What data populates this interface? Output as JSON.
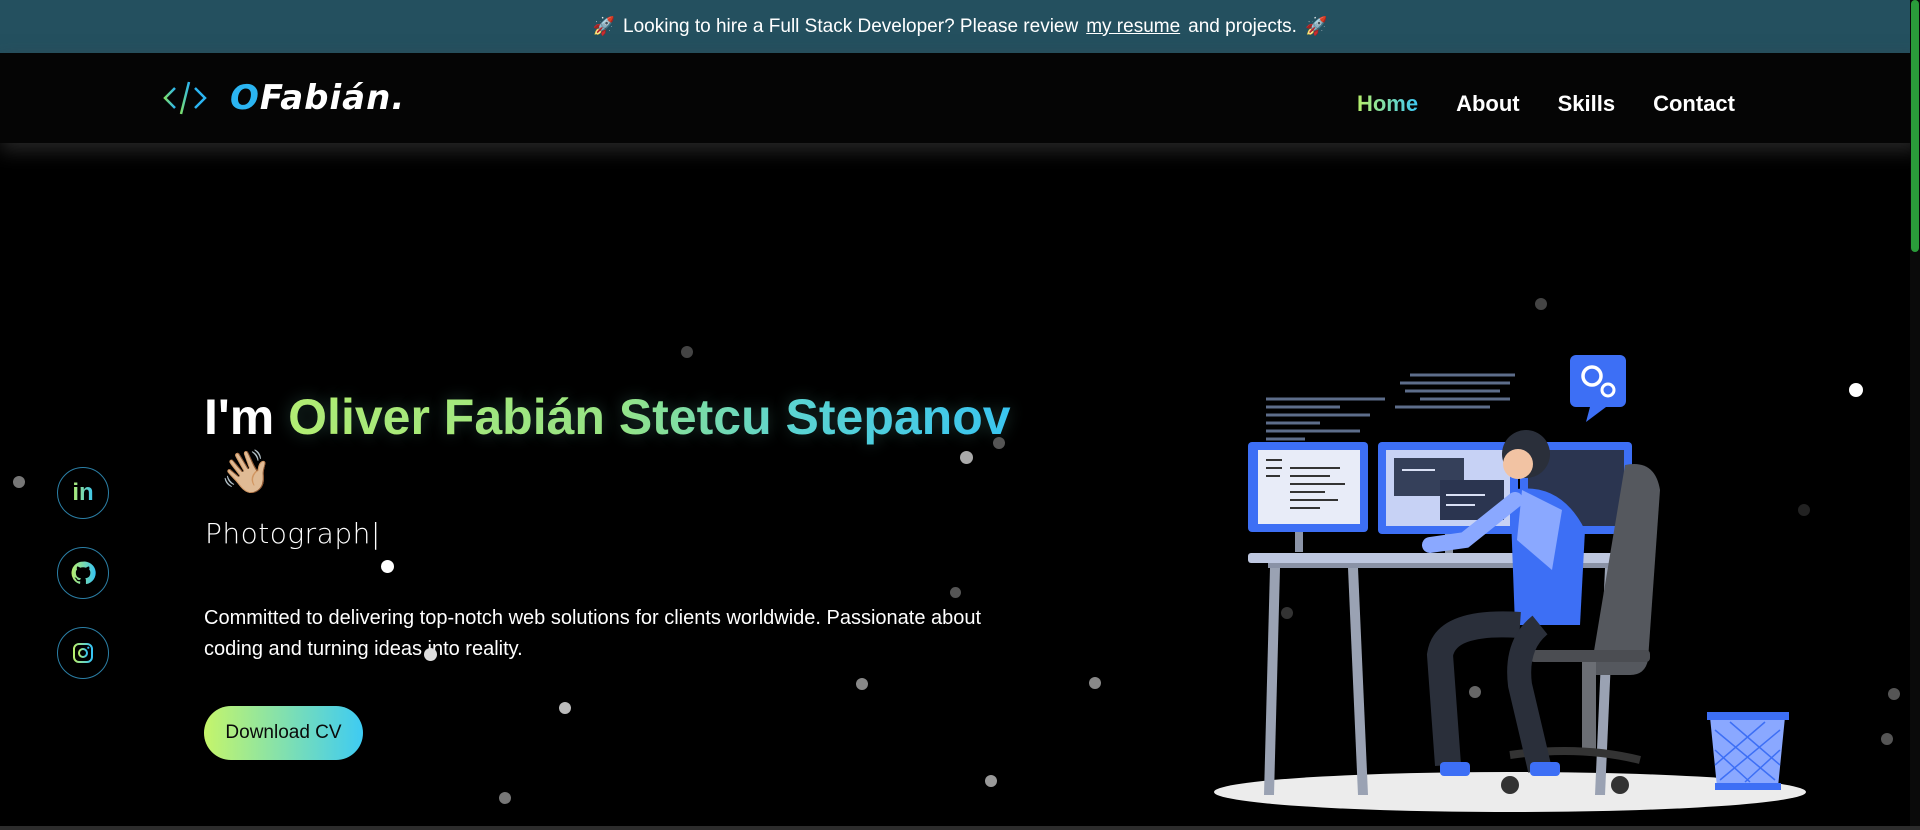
{
  "banner": {
    "text_before": "Looking to hire a Full Stack Developer? Please review",
    "link_text": "my resume",
    "text_after": "and projects.",
    "icon": "rocket-icon"
  },
  "logo": {
    "icon": "code-brackets-icon",
    "text_o": "O",
    "text_rest": "Fabián."
  },
  "nav": {
    "items": [
      "Home",
      "About",
      "Skills",
      "Contact"
    ],
    "active": "Home"
  },
  "social": [
    {
      "name": "linkedin",
      "icon": "linkedin-icon",
      "label": "in"
    },
    {
      "name": "github",
      "icon": "github-icon"
    },
    {
      "name": "instagram",
      "icon": "instagram-icon"
    }
  ],
  "hero": {
    "prefix": "I'm",
    "name": "Oliver Fabián Stetcu Stepanov",
    "wave_emoji": "👋🏼",
    "typing_text": "Photograph",
    "description": "Committed to delivering top-notch web solutions for clients worldwide. Passionate about coding and turning ideas into reality.",
    "cta_label": "Download CV"
  },
  "colors": {
    "banner_bg": "#24505f",
    "accent_green": "#b8ef6d",
    "accent_blue": "#35c4f5",
    "scroll_thumb": "#2a9c3a"
  }
}
